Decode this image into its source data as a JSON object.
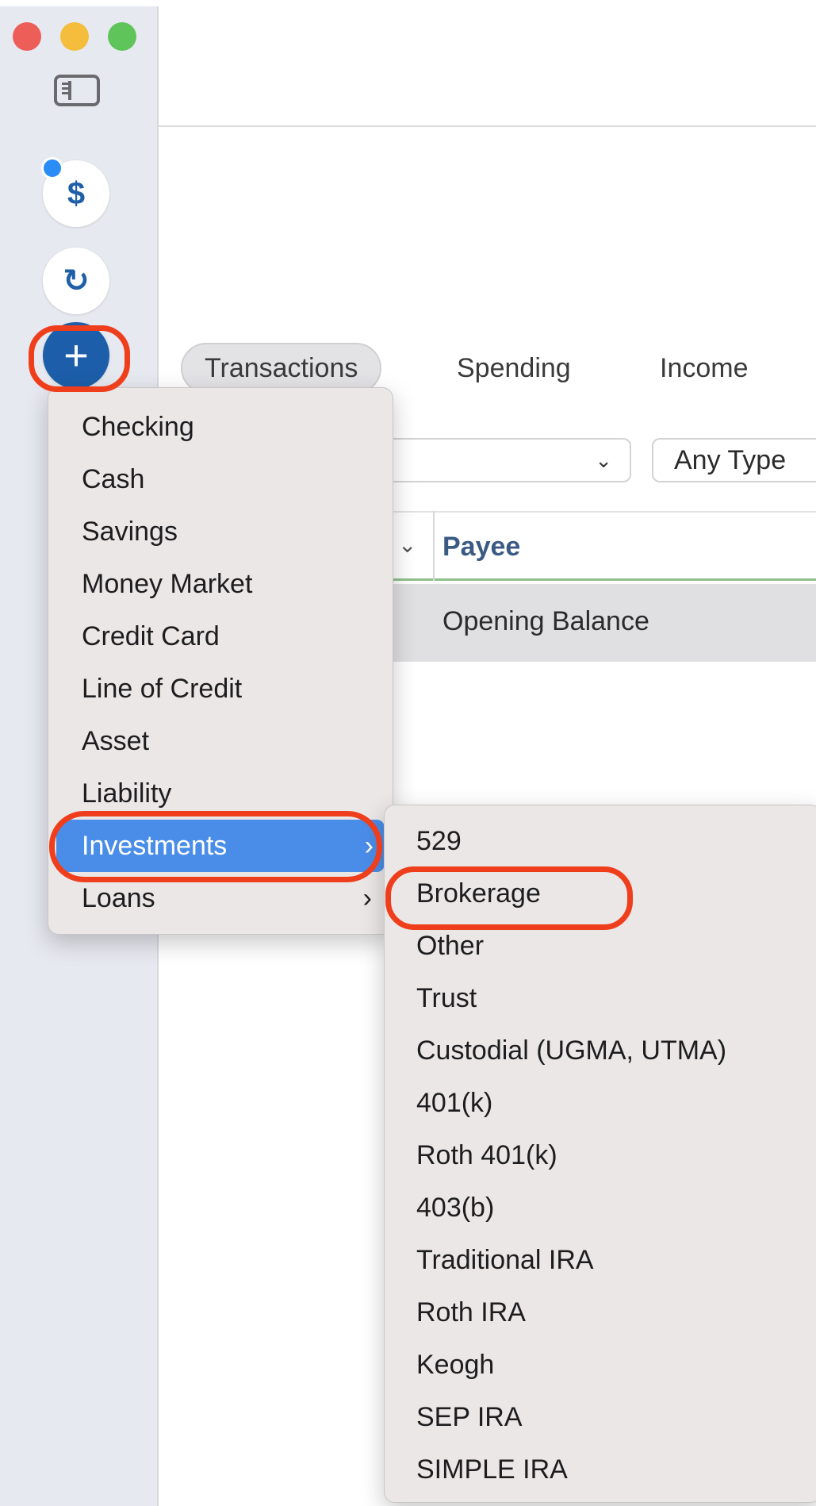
{
  "sidebar": {
    "buttons": [
      {
        "icon": "dollar-icon",
        "glyph": "$"
      },
      {
        "icon": "refresh-icon",
        "glyph": "↻"
      },
      {
        "icon": "plus-icon",
        "glyph": "+"
      }
    ]
  },
  "tabs": [
    {
      "label": "Transactions",
      "active": true
    },
    {
      "label": "Spending",
      "active": false
    },
    {
      "label": "Income",
      "active": false
    }
  ],
  "filters": {
    "first_value": "",
    "second_value": "Any Type",
    "chevron": "⌄"
  },
  "table": {
    "columns": [
      "Payee"
    ],
    "header_chevron": "⌄",
    "rows": [
      {
        "payee": "Opening Balance"
      }
    ]
  },
  "add_menu": {
    "items": [
      {
        "label": "Checking"
      },
      {
        "label": "Cash"
      },
      {
        "label": "Savings"
      },
      {
        "label": "Money Market"
      },
      {
        "label": "Credit Card"
      },
      {
        "label": "Line of Credit"
      },
      {
        "label": "Asset"
      },
      {
        "label": "Liability"
      },
      {
        "label": "Investments",
        "submenu": true,
        "highlighted": true
      },
      {
        "label": "Loans",
        "submenu": true
      }
    ],
    "submenu_arrow": "›"
  },
  "investments_submenu": {
    "items": [
      {
        "label": "529"
      },
      {
        "label": "Brokerage",
        "annotated": true
      },
      {
        "label": "Other"
      },
      {
        "label": "Trust"
      },
      {
        "label": "Custodial (UGMA, UTMA)"
      },
      {
        "label": "401(k)"
      },
      {
        "label": "Roth 401(k)"
      },
      {
        "label": "403(b)"
      },
      {
        "label": "Traditional IRA"
      },
      {
        "label": "Roth IRA"
      },
      {
        "label": "Keogh"
      },
      {
        "label": "SEP IRA"
      },
      {
        "label": "SIMPLE IRA"
      }
    ]
  },
  "colors": {
    "accent_blue": "#1c5ea9",
    "menu_highlight": "#4a8de8",
    "annotation_red": "#ef3e1c",
    "badge_blue": "#2a8cf5"
  }
}
